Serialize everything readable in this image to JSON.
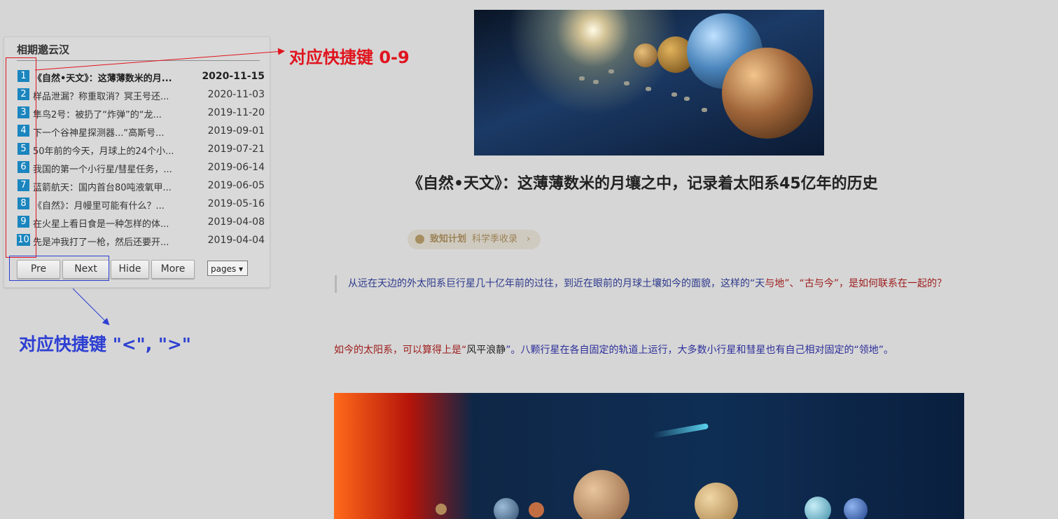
{
  "panel": {
    "title": "相期邈云汉",
    "items": [
      {
        "num": "1",
        "title": "《自然•天文》：这薄薄数米的月...",
        "date": "2020-11-15",
        "active": true
      },
      {
        "num": "2",
        "title": "样品泄漏？称重取消？冥王号还...",
        "date": "2020-11-03"
      },
      {
        "num": "3",
        "title": "隼鸟2号：被扔了“炸弹”的“龙...",
        "date": "2019-11-20"
      },
      {
        "num": "4",
        "title": "下一个谷神星探测器...“高斯号...",
        "date": "2019-09-01"
      },
      {
        "num": "5",
        "title": "50年前的今天，月球上的24个小...",
        "date": "2019-07-21"
      },
      {
        "num": "6",
        "title": "我国的第一个小行星/彗星任务，...",
        "date": "2019-06-14"
      },
      {
        "num": "7",
        "title": "蓝箭航天：国内首台80吨液氧甲...",
        "date": "2019-06-05"
      },
      {
        "num": "8",
        "title": "《自然》：月幔里可能有什么？...",
        "date": "2019-05-16"
      },
      {
        "num": "9",
        "title": "在火星上看日食是一种怎样的体...",
        "date": "2019-04-08"
      },
      {
        "num": "10",
        "title": "先是冲我打了一枪，然后还要开...",
        "date": "2019-04-04"
      }
    ],
    "buttons": {
      "pre": "Pre",
      "next": "Next",
      "hide": "Hide",
      "more": "More"
    },
    "pages_select": "pages ▾"
  },
  "annotations": {
    "red": "对应快捷键 0-9",
    "blue": "对应快捷键 \"<\", \">\""
  },
  "article": {
    "title": "《自然•天文》：这薄薄数米的月壤之中，记录着太阳系45亿年的历史",
    "pill": {
      "brand": "致知计划",
      "tag": "科学季收录",
      "chevron": "›"
    },
    "quote": {
      "p1": "从远在天边的外太阳系巨行星几十亿年前的过往，到近在眼前的月球土壤如今的面貌，这样的“天",
      "p2": "与地",
      "p3": "”、“古与今”，是如何联系在一起的？"
    },
    "para": {
      "p1": "如今的太阳系，可以算得上是“",
      "p2": "风平浪静",
      "p3": "”。八颗行星在各自固定的轨道上运行，大多数小行星和彗星也有自己相对固定的“领地”。"
    }
  },
  "colors": {
    "accent_blue": "#1a85be",
    "annotation_red": "#e0141e",
    "annotation_blue": "#2d3fd2"
  }
}
